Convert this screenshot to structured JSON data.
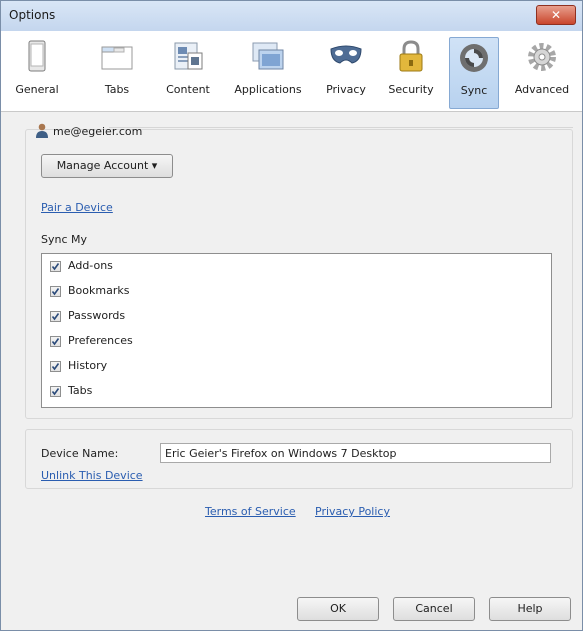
{
  "window": {
    "title": "Options",
    "close_glyph": "✕"
  },
  "toolbar": {
    "tabs": [
      {
        "label": "General",
        "icon": "general-icon"
      },
      {
        "label": "Tabs",
        "icon": "tabs-icon"
      },
      {
        "label": "Content",
        "icon": "content-icon"
      },
      {
        "label": "Applications",
        "icon": "applications-icon"
      },
      {
        "label": "Privacy",
        "icon": "privacy-mask-icon"
      },
      {
        "label": "Security",
        "icon": "padlock-icon"
      },
      {
        "label": "Sync",
        "icon": "sync-icon",
        "selected": true
      },
      {
        "label": "Advanced",
        "icon": "gear-icon"
      }
    ]
  },
  "sync": {
    "account": "me@egeier.com",
    "manage_account_label": "Manage Account ▾",
    "pair_device_label": "Pair a Device",
    "sync_my_label": "Sync My",
    "items": [
      {
        "label": "Add-ons",
        "checked": true
      },
      {
        "label": "Bookmarks",
        "checked": true
      },
      {
        "label": "Passwords",
        "checked": true
      },
      {
        "label": "Preferences",
        "checked": true
      },
      {
        "label": "History",
        "checked": true
      },
      {
        "label": "Tabs",
        "checked": true
      }
    ],
    "device_name_label": "Device Name:",
    "device_name_value": "Eric Geier's Firefox on Windows 7 Desktop",
    "unlink_label": "Unlink This Device",
    "terms_label": "Terms of Service",
    "privacy_label": "Privacy Policy"
  },
  "buttons": {
    "ok": "OK",
    "cancel": "Cancel",
    "help": "Help"
  },
  "colors": {
    "link": "#2a5db0",
    "selected_tab": "#c6dcf3",
    "close_button": "#c9462c"
  }
}
